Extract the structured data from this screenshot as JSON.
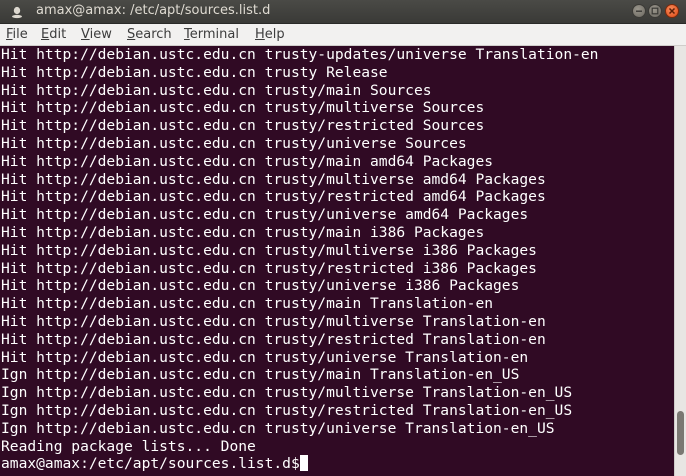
{
  "window": {
    "title": "amax@amax: /etc/apt/sources.list.d"
  },
  "menu": [
    {
      "key": "F",
      "rest": "ile"
    },
    {
      "key": "E",
      "rest": "dit"
    },
    {
      "key": "V",
      "rest": "iew"
    },
    {
      "key": "S",
      "rest": "earch"
    },
    {
      "key": "T",
      "rest": "erminal"
    },
    {
      "key": "H",
      "rest": "elp"
    }
  ],
  "terminal": {
    "lines": [
      "Hit http://debian.ustc.edu.cn trusty-updates/universe Translation-en",
      "Hit http://debian.ustc.edu.cn trusty Release",
      "Hit http://debian.ustc.edu.cn trusty/main Sources",
      "Hit http://debian.ustc.edu.cn trusty/multiverse Sources",
      "Hit http://debian.ustc.edu.cn trusty/restricted Sources",
      "Hit http://debian.ustc.edu.cn trusty/universe Sources",
      "Hit http://debian.ustc.edu.cn trusty/main amd64 Packages",
      "Hit http://debian.ustc.edu.cn trusty/multiverse amd64 Packages",
      "Hit http://debian.ustc.edu.cn trusty/restricted amd64 Packages",
      "Hit http://debian.ustc.edu.cn trusty/universe amd64 Packages",
      "Hit http://debian.ustc.edu.cn trusty/main i386 Packages",
      "Hit http://debian.ustc.edu.cn trusty/multiverse i386 Packages",
      "Hit http://debian.ustc.edu.cn trusty/restricted i386 Packages",
      "Hit http://debian.ustc.edu.cn trusty/universe i386 Packages",
      "Hit http://debian.ustc.edu.cn trusty/main Translation-en",
      "Hit http://debian.ustc.edu.cn trusty/multiverse Translation-en",
      "Hit http://debian.ustc.edu.cn trusty/restricted Translation-en",
      "Hit http://debian.ustc.edu.cn trusty/universe Translation-en",
      "Ign http://debian.ustc.edu.cn trusty/main Translation-en_US",
      "Ign http://debian.ustc.edu.cn trusty/multiverse Translation-en_US",
      "Ign http://debian.ustc.edu.cn trusty/restricted Translation-en_US",
      "Ign http://debian.ustc.edu.cn trusty/universe Translation-en_US",
      "Reading package lists... Done"
    ],
    "prompt": "amax@amax:/etc/apt/sources.list.d$",
    "scroll_position": 0.95
  },
  "colors": {
    "terminal_bg": "#300a24",
    "terminal_fg": "#ffffff",
    "close_button": "#df4a16"
  },
  "icons": {
    "app": "terminal-app-icon",
    "minimize": "minimize-icon",
    "maximize": "maximize-icon",
    "close": "close-icon"
  }
}
